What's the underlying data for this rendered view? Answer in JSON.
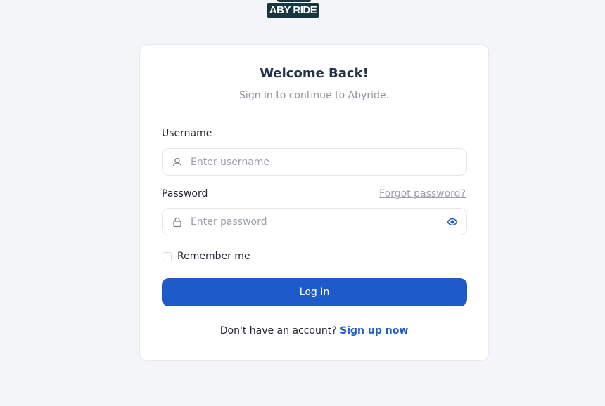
{
  "logo": {
    "text": "ABY RIDE"
  },
  "login": {
    "title": "Welcome Back!",
    "subtitle": "Sign in to continue to Abyride.",
    "username": {
      "label": "Username",
      "placeholder": "Enter username",
      "value": "",
      "icon": "user-icon"
    },
    "password": {
      "label": "Password",
      "placeholder": "Enter password",
      "value": "",
      "icon": "lock-icon",
      "toggle_icon": "eye-icon",
      "forgot_label": "Forgot password?"
    },
    "remember": {
      "label": "Remember me",
      "checked": false
    },
    "submit_label": "Log In",
    "signup_prompt": "Don't have an account?",
    "signup_link": "Sign up now"
  },
  "colors": {
    "background": "#f3f5f8",
    "primary": "#1f5acb",
    "heading": "#26324a",
    "muted": "#8c93a0",
    "logo_bg": "#17353f"
  }
}
